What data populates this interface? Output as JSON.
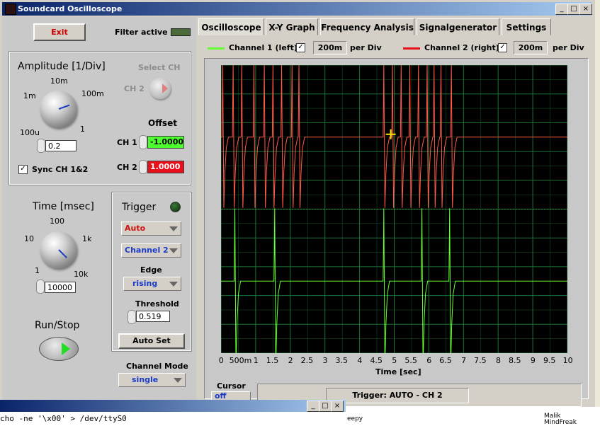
{
  "window": {
    "title": "Soundcard Oscilloscope"
  },
  "controls": {
    "exit_label": "Exit",
    "filter_label": "Filter active",
    "amplitude": {
      "title": "Amplitude [1/Div]",
      "scale": [
        "10m",
        "1m",
        "100m",
        "100u",
        "1"
      ],
      "value": "0.2",
      "sync_label": "Sync CH 1&2",
      "sync_checked": "✓"
    },
    "select_ch": {
      "title": "Select CH",
      "value": "CH 2"
    },
    "offset": {
      "title": "Offset",
      "ch1_label": "CH 1",
      "ch1_value": "-1.0000",
      "ch2_label": "CH 2",
      "ch2_value": "1.0000"
    },
    "time": {
      "title": "Time [msec]",
      "scale": [
        "100",
        "10",
        "1k",
        "1",
        "10k"
      ],
      "value": "10000"
    },
    "trigger": {
      "title": "Trigger",
      "mode": "Auto",
      "channel": "Channel 2",
      "edge_label": "Edge",
      "edge": "rising",
      "threshold_label": "Threshold",
      "threshold": "0.519",
      "autoset_label": "Auto Set"
    },
    "run_stop_label": "Run/Stop",
    "channel_mode_label": "Channel Mode",
    "channel_mode": "single"
  },
  "tabs": [
    "Oscilloscope",
    "X-Y Graph",
    "Frequency Analysis",
    "Signalgenerator",
    "Settings"
  ],
  "legend": {
    "ch1_label": "Channel 1 (left)",
    "ch1_checked": "✓",
    "ch1_div": "200m",
    "ch1_per": "per Div",
    "ch2_label": "Channel 2 (right)",
    "ch2_checked": "✓",
    "ch2_div": "200m",
    "ch2_per": "per Div"
  },
  "colors": {
    "ch1": "#66ff33",
    "ch2": "#ff5a4a",
    "grid": "#1f7a3a",
    "plot_bg": "#000000",
    "exit": "#cc0000"
  },
  "chart_data": {
    "type": "line",
    "xlabel": "Time [sec]",
    "xlim": [
      0,
      10
    ],
    "x_ticks": [
      "0",
      "500m",
      "1",
      "1.5",
      "2",
      "2.5",
      "3",
      "3.5",
      "4",
      "4.5",
      "5",
      "5.5",
      "6",
      "6.5",
      "7",
      "7.5",
      "8",
      "8.5",
      "9",
      "9.5",
      "10"
    ],
    "series": [
      {
        "name": "Channel 2 (right)",
        "baseline_div": 1.0,
        "pulse_times": [
          0.05,
          0.35,
          0.6,
          0.95,
          1.25,
          1.5,
          1.75,
          2.05,
          2.25,
          4.7,
          4.95,
          5.2,
          5.45,
          5.7,
          5.95,
          6.15,
          6.35,
          6.65
        ]
      },
      {
        "name": "Channel 1 (left)",
        "baseline_div": -1.0,
        "pulse_times": [
          0.4,
          1.55,
          4.7,
          5.8,
          6.6
        ]
      }
    ]
  },
  "cursor_label": "Cursor",
  "cursor_value": "off",
  "status": {
    "trigger_text": "Trigger: AUTO - CH 2"
  },
  "terminal": {
    "command": "cho -ne '\\x00' > /dev/ttyS0"
  },
  "behind": {
    "text1": "eepy",
    "text2": "Malik",
    "text3": "MindFreak"
  }
}
